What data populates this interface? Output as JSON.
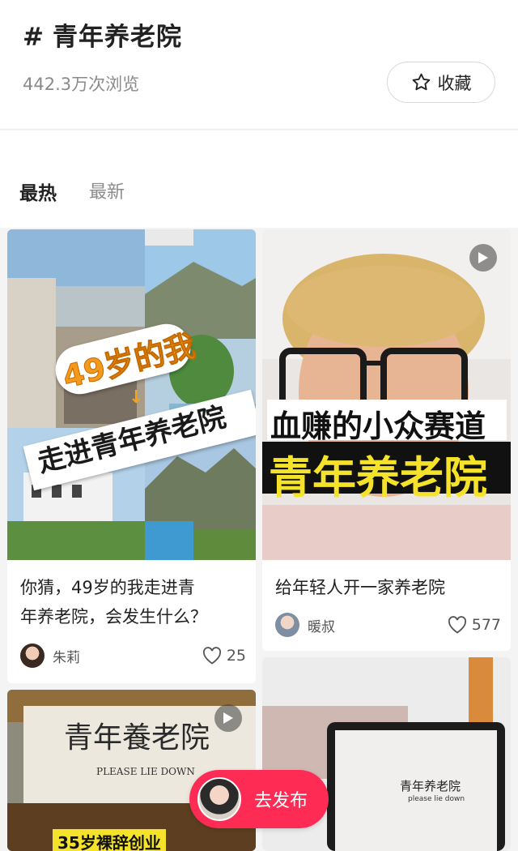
{
  "topic": {
    "hash": "#",
    "title": "青年养老院",
    "views": "442.3万次浏览",
    "favorite_label": "收藏"
  },
  "tabs": {
    "hot": "最热",
    "latest": "最新"
  },
  "cards": [
    {
      "image_texts": {
        "line1": "49岁的我",
        "line2": "走进青年养老院"
      },
      "title_line1": "你猜，49岁的我走进青",
      "title_line2": "年养老院，会发生什么？",
      "author": "朱莉",
      "likes": "25",
      "has_play_icon": false
    },
    {
      "image_texts": {
        "line1": "血赚的小众赛道",
        "line2": "青年养老院"
      },
      "title_line1": "给年轻人开一家养老院",
      "author": "暖叔",
      "likes": "577",
      "has_play_icon": true
    },
    {
      "image_texts": {
        "sign_main": "青年養老院",
        "sign_sub": "PLEASE LIE DOWN",
        "caption": "35岁裸辞创业"
      },
      "has_play_icon": true
    },
    {
      "image_texts": {
        "screen_main": "青年养老院",
        "screen_sub": "please lie down"
      },
      "has_play_icon": false
    }
  ],
  "publish": {
    "label": "去发布"
  },
  "colors": {
    "accent": "#fe2c55",
    "yellow_text": "#f5e22a",
    "green_text": "#2fd16a"
  }
}
